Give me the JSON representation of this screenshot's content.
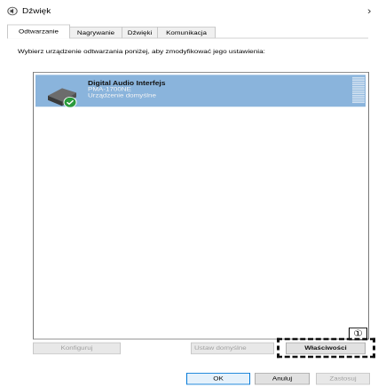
{
  "window": {
    "title": "Dźwięk",
    "icon": "speaker-icon",
    "close_glyph": "×"
  },
  "tabs": [
    {
      "label": "Odtwarzanie",
      "active": true
    },
    {
      "label": "Nagrywanie",
      "active": false
    },
    {
      "label": "Dźwięki",
      "active": false
    },
    {
      "label": "Komunikacja",
      "active": false
    }
  ],
  "instruction": "Wybierz urządzenie odtwarzania poniżej, aby zmodyfikować jego ustawienia:",
  "device": {
    "name": "Digital Audio Interfejs",
    "model": "PMA-1700NE",
    "status": "Urządzenie domyślne",
    "icon": "speaker-icon",
    "badge_icon": "checkmark-icon",
    "selected_color": "#8ab4dc"
  },
  "callout": {
    "label": "①"
  },
  "buttons": {
    "configure": "Konfiguruj",
    "set_default": "Ustaw domyślne",
    "properties": "Właściwości",
    "ok": "OK",
    "cancel": "Anuluj",
    "apply": "Zastosuj"
  }
}
